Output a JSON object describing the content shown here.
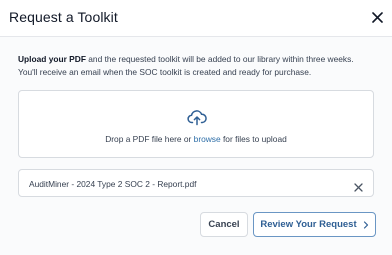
{
  "dialog": {
    "title": "Request a Toolkit"
  },
  "intro": {
    "bold": "Upload your PDF",
    "rest_line1": " and the requested toolkit will be added to our library within three weeks.",
    "line2": "You'll receive an email when the SOC toolkit is created and ready for purchase."
  },
  "dropzone": {
    "icon": "cloud-upload-icon",
    "text_before": "Drop a PDF file here or ",
    "link": "browse",
    "text_after": " for files to upload"
  },
  "file": {
    "name": "AuditMiner - 2024 Type 2 SOC 2 - Report.pdf",
    "remove_icon": "close-icon"
  },
  "actions": {
    "cancel_label": "Cancel",
    "review_label": "Review Your Request",
    "review_icon": "chevron-right-icon"
  },
  "colors": {
    "accent": "#2f5f94",
    "link": "#2f6fa8",
    "border": "#d7dbe0"
  }
}
